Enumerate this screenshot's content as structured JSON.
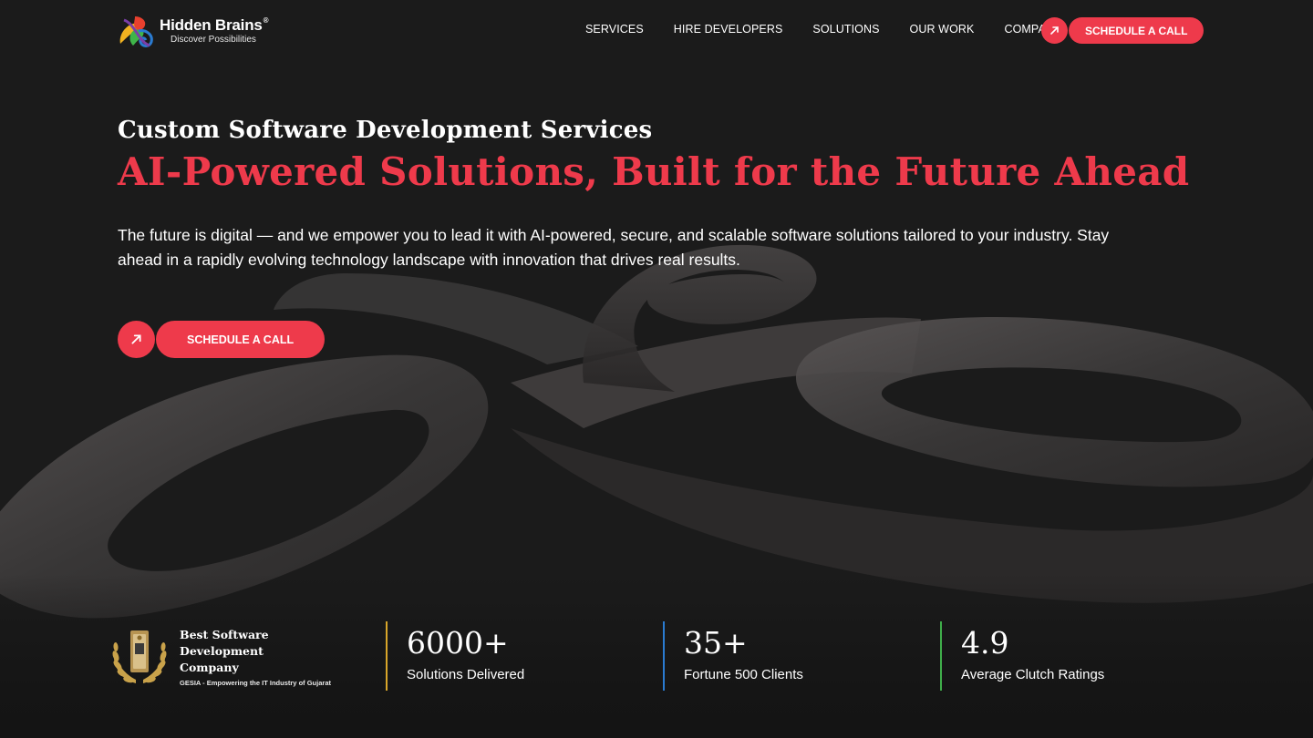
{
  "brand": {
    "name": "Hidden Brains",
    "registered": "®",
    "tagline": "Discover Possibilities",
    "colors": {
      "accent": "#ee3a4b",
      "background": "#1b1b1b"
    }
  },
  "nav": {
    "items": [
      {
        "label": "SERVICES"
      },
      {
        "label": "HIRE DEVELOPERS"
      },
      {
        "label": "SOLUTIONS"
      },
      {
        "label": "OUR WORK"
      },
      {
        "label": "COMPANY"
      }
    ],
    "cta_label": "SCHEDULE A CALL",
    "cta_icon": "arrow-up-right-icon"
  },
  "hero": {
    "subtitle": "Custom Software Development Services",
    "title": "AI-Powered Solutions, Built for the Future Ahead",
    "description": "The future is digital — and we empower you to lead it with AI-powered, secure, and scalable software solutions tailored to your industry. Stay ahead in a rapidly evolving technology landscape with innovation that drives real results.",
    "cta_label": "SCHEDULE A CALL",
    "cta_icon": "arrow-up-right-icon"
  },
  "stats": {
    "award": {
      "title": "Best Software Development Company",
      "subtitle": "GESIA - Empowering the IT Industry of Gujarat",
      "icon": "laurel-award-icon"
    },
    "items": [
      {
        "value": "6000+",
        "label": "Solutions Delivered",
        "color": "#d9a62a"
      },
      {
        "value": "35+",
        "label": "Fortune 500 Clients",
        "color": "#2a7bd1"
      },
      {
        "value": "4.9",
        "label": "Average Clutch Ratings",
        "color": "#3fae4a"
      }
    ]
  }
}
